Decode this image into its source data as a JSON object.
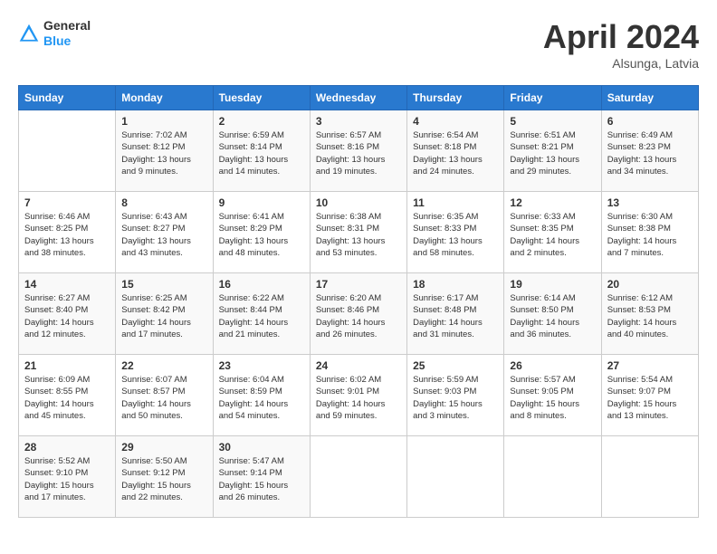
{
  "logo": {
    "line1": "General",
    "line2": "Blue"
  },
  "title": "April 2024",
  "location": "Alsunga, Latvia",
  "days_of_week": [
    "Sunday",
    "Monday",
    "Tuesday",
    "Wednesday",
    "Thursday",
    "Friday",
    "Saturday"
  ],
  "weeks": [
    [
      {
        "day": "",
        "info": ""
      },
      {
        "day": "1",
        "info": "Sunrise: 7:02 AM\nSunset: 8:12 PM\nDaylight: 13 hours\nand 9 minutes."
      },
      {
        "day": "2",
        "info": "Sunrise: 6:59 AM\nSunset: 8:14 PM\nDaylight: 13 hours\nand 14 minutes."
      },
      {
        "day": "3",
        "info": "Sunrise: 6:57 AM\nSunset: 8:16 PM\nDaylight: 13 hours\nand 19 minutes."
      },
      {
        "day": "4",
        "info": "Sunrise: 6:54 AM\nSunset: 8:18 PM\nDaylight: 13 hours\nand 24 minutes."
      },
      {
        "day": "5",
        "info": "Sunrise: 6:51 AM\nSunset: 8:21 PM\nDaylight: 13 hours\nand 29 minutes."
      },
      {
        "day": "6",
        "info": "Sunrise: 6:49 AM\nSunset: 8:23 PM\nDaylight: 13 hours\nand 34 minutes."
      }
    ],
    [
      {
        "day": "7",
        "info": "Sunrise: 6:46 AM\nSunset: 8:25 PM\nDaylight: 13 hours\nand 38 minutes."
      },
      {
        "day": "8",
        "info": "Sunrise: 6:43 AM\nSunset: 8:27 PM\nDaylight: 13 hours\nand 43 minutes."
      },
      {
        "day": "9",
        "info": "Sunrise: 6:41 AM\nSunset: 8:29 PM\nDaylight: 13 hours\nand 48 minutes."
      },
      {
        "day": "10",
        "info": "Sunrise: 6:38 AM\nSunset: 8:31 PM\nDaylight: 13 hours\nand 53 minutes."
      },
      {
        "day": "11",
        "info": "Sunrise: 6:35 AM\nSunset: 8:33 PM\nDaylight: 13 hours\nand 58 minutes."
      },
      {
        "day": "12",
        "info": "Sunrise: 6:33 AM\nSunset: 8:35 PM\nDaylight: 14 hours\nand 2 minutes."
      },
      {
        "day": "13",
        "info": "Sunrise: 6:30 AM\nSunset: 8:38 PM\nDaylight: 14 hours\nand 7 minutes."
      }
    ],
    [
      {
        "day": "14",
        "info": "Sunrise: 6:27 AM\nSunset: 8:40 PM\nDaylight: 14 hours\nand 12 minutes."
      },
      {
        "day": "15",
        "info": "Sunrise: 6:25 AM\nSunset: 8:42 PM\nDaylight: 14 hours\nand 17 minutes."
      },
      {
        "day": "16",
        "info": "Sunrise: 6:22 AM\nSunset: 8:44 PM\nDaylight: 14 hours\nand 21 minutes."
      },
      {
        "day": "17",
        "info": "Sunrise: 6:20 AM\nSunset: 8:46 PM\nDaylight: 14 hours\nand 26 minutes."
      },
      {
        "day": "18",
        "info": "Sunrise: 6:17 AM\nSunset: 8:48 PM\nDaylight: 14 hours\nand 31 minutes."
      },
      {
        "day": "19",
        "info": "Sunrise: 6:14 AM\nSunset: 8:50 PM\nDaylight: 14 hours\nand 36 minutes."
      },
      {
        "day": "20",
        "info": "Sunrise: 6:12 AM\nSunset: 8:53 PM\nDaylight: 14 hours\nand 40 minutes."
      }
    ],
    [
      {
        "day": "21",
        "info": "Sunrise: 6:09 AM\nSunset: 8:55 PM\nDaylight: 14 hours\nand 45 minutes."
      },
      {
        "day": "22",
        "info": "Sunrise: 6:07 AM\nSunset: 8:57 PM\nDaylight: 14 hours\nand 50 minutes."
      },
      {
        "day": "23",
        "info": "Sunrise: 6:04 AM\nSunset: 8:59 PM\nDaylight: 14 hours\nand 54 minutes."
      },
      {
        "day": "24",
        "info": "Sunrise: 6:02 AM\nSunset: 9:01 PM\nDaylight: 14 hours\nand 59 minutes."
      },
      {
        "day": "25",
        "info": "Sunrise: 5:59 AM\nSunset: 9:03 PM\nDaylight: 15 hours\nand 3 minutes."
      },
      {
        "day": "26",
        "info": "Sunrise: 5:57 AM\nSunset: 9:05 PM\nDaylight: 15 hours\nand 8 minutes."
      },
      {
        "day": "27",
        "info": "Sunrise: 5:54 AM\nSunset: 9:07 PM\nDaylight: 15 hours\nand 13 minutes."
      }
    ],
    [
      {
        "day": "28",
        "info": "Sunrise: 5:52 AM\nSunset: 9:10 PM\nDaylight: 15 hours\nand 17 minutes."
      },
      {
        "day": "29",
        "info": "Sunrise: 5:50 AM\nSunset: 9:12 PM\nDaylight: 15 hours\nand 22 minutes."
      },
      {
        "day": "30",
        "info": "Sunrise: 5:47 AM\nSunset: 9:14 PM\nDaylight: 15 hours\nand 26 minutes."
      },
      {
        "day": "",
        "info": ""
      },
      {
        "day": "",
        "info": ""
      },
      {
        "day": "",
        "info": ""
      },
      {
        "day": "",
        "info": ""
      }
    ]
  ]
}
